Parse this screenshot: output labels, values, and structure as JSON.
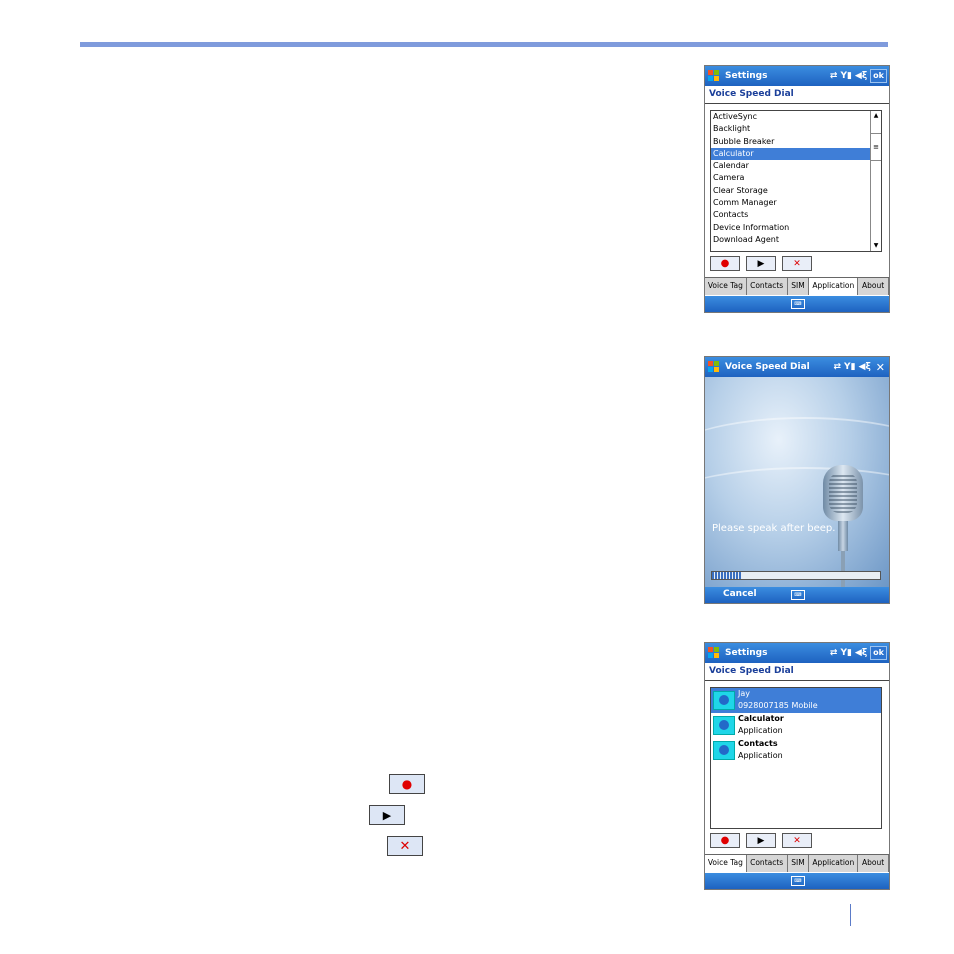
{
  "screen1": {
    "title": "Settings",
    "ok_label": "ok",
    "header": "Voice Speed Dial",
    "items": [
      {
        "label": "ActiveSync"
      },
      {
        "label": "Backlight"
      },
      {
        "label": "Bubble Breaker"
      },
      {
        "label": "Calculator",
        "selected": true,
        "tagged": true
      },
      {
        "label": "Calendar"
      },
      {
        "label": "Camera"
      },
      {
        "label": "Clear Storage"
      },
      {
        "label": "Comm Manager"
      },
      {
        "label": "Contacts",
        "tagged": true
      },
      {
        "label": "Device Information"
      },
      {
        "label": "Download Agent"
      }
    ],
    "tabs": [
      "Voice Tag",
      "Contacts",
      "SIM",
      "Application",
      "About"
    ],
    "active_tab": "Application"
  },
  "screen2": {
    "title": "Voice Speed Dial",
    "prompt": "Please speak after beep.",
    "cancel_label": "Cancel",
    "progress": 0.18
  },
  "screen3": {
    "title": "Settings",
    "ok_label": "ok",
    "header": "Voice Speed Dial",
    "entries": [
      {
        "name": "Jay",
        "detail": "0928007185 Mobile",
        "selected": true
      },
      {
        "name": "Calculator",
        "detail": "Application"
      },
      {
        "name": "Contacts",
        "detail": "Application"
      }
    ],
    "tabs": [
      "Voice Tag",
      "Contacts",
      "SIM",
      "Application",
      "About"
    ],
    "active_tab": "Voice Tag"
  },
  "icons": {
    "record": "record-icon",
    "play": "play-icon",
    "delete": "delete-x-icon",
    "start": "windows-flag-icon",
    "sync": "sync-arrows-icon",
    "signal": "signal-icon",
    "volume": "speaker-icon",
    "keyboard": "keyboard-icon",
    "tag": "voice-tag-icon"
  },
  "colors": {
    "titlebar": "#1e62c0",
    "selection": "#3f7ed7",
    "header_text": "#1b3f9a",
    "record_red": "#e00000",
    "rule_blue": "#7f9bdc"
  }
}
